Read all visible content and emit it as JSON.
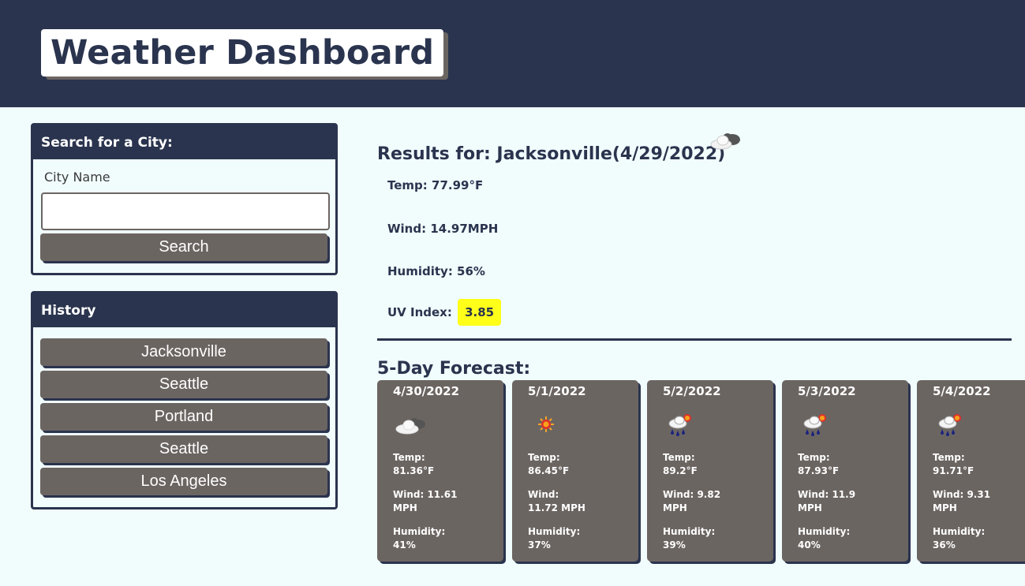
{
  "header": {
    "title": "Weather Dashboard"
  },
  "search": {
    "heading": "Search for a City:",
    "label": "City Name",
    "input_value": "",
    "button_label": "Search"
  },
  "history": {
    "heading": "History",
    "items": [
      "Jacksonville",
      "Seattle",
      "Portland",
      "Seattle",
      "Los Angeles"
    ]
  },
  "current": {
    "title": "Results for: Jacksonville(4/29/2022)",
    "icon": "cloud-icon",
    "temp": "Temp: 77.99°F",
    "wind": "Wind: 14.97MPH",
    "humidity": "Humidity: 56%",
    "uv_label": "UV Index:",
    "uv_value": "3.85",
    "uv_color": "#ffff1a"
  },
  "forecast": {
    "title": "5-Day Forecast:",
    "days": [
      {
        "date": "4/30/2022",
        "icon": "cloud-icon",
        "temp_label": "Temp:",
        "temp": "81.36°F",
        "wind_label": "Wind: 11.61",
        "wind": "MPH",
        "humidity_label": "Humidity:",
        "humidity": "41%"
      },
      {
        "date": "5/1/2022",
        "icon": "sun-icon",
        "temp_label": "Temp:",
        "temp": "86.45°F",
        "wind_label": "Wind:",
        "wind": "11.72 MPH",
        "humidity_label": "Humidity:",
        "humidity": "37%"
      },
      {
        "date": "5/2/2022",
        "icon": "rain-sun-icon",
        "temp_label": "Temp:",
        "temp": "89.2°F",
        "wind_label": "Wind: 9.82",
        "wind": "MPH",
        "humidity_label": "Humidity:",
        "humidity": "39%"
      },
      {
        "date": "5/3/2022",
        "icon": "rain-sun-icon",
        "temp_label": "Temp:",
        "temp": "87.93°F",
        "wind_label": "Wind: 11.9",
        "wind": "MPH",
        "humidity_label": "Humidity:",
        "humidity": "40%"
      },
      {
        "date": "5/4/2022",
        "icon": "rain-sun-icon",
        "temp_label": "Temp:",
        "temp": "91.71°F",
        "wind_label": "Wind: 9.31",
        "wind": "MPH",
        "humidity_label": "Humidity:",
        "humidity": "36%"
      }
    ]
  },
  "colors": {
    "header_bg": "#2a344e",
    "page_bg": "#f1fcfd",
    "button_bg": "#6b6562",
    "card_bg": "#6b6562"
  }
}
